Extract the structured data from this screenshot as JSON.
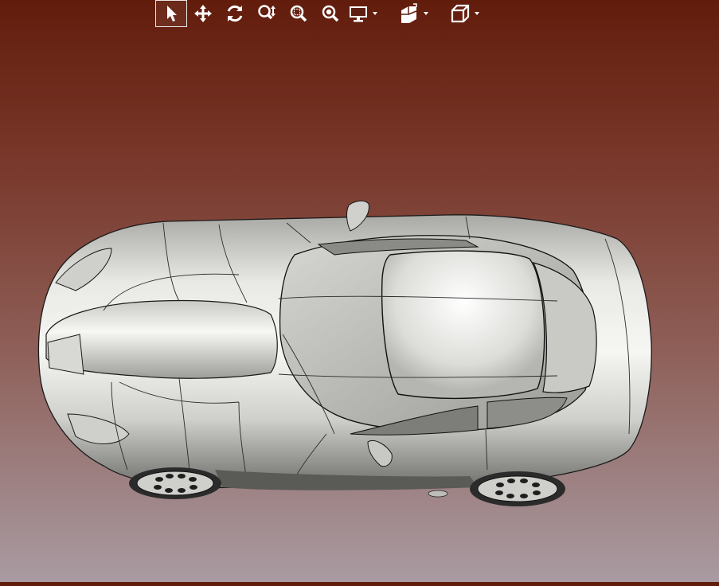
{
  "toolbar": {
    "tools": [
      {
        "icon": "select-arrow-icon",
        "active": true
      },
      {
        "icon": "pan-move-icon"
      },
      {
        "icon": "rotate-orbit-icon"
      },
      {
        "icon": "zoom-in-out-icon"
      },
      {
        "icon": "zoom-window-icon"
      },
      {
        "icon": "zoom-fit-icon"
      },
      {
        "icon": "display-mode-icon",
        "dropdown": true
      },
      {
        "icon": "section-view-icon",
        "dropdown": true
      },
      {
        "icon": "standard-view-cube-icon",
        "dropdown": true
      }
    ]
  },
  "viewport": {
    "background_top": "#621c0c",
    "background_bottom": "#a99ba2",
    "model_color": "#d8d8d4",
    "model": "car-3d-model"
  }
}
